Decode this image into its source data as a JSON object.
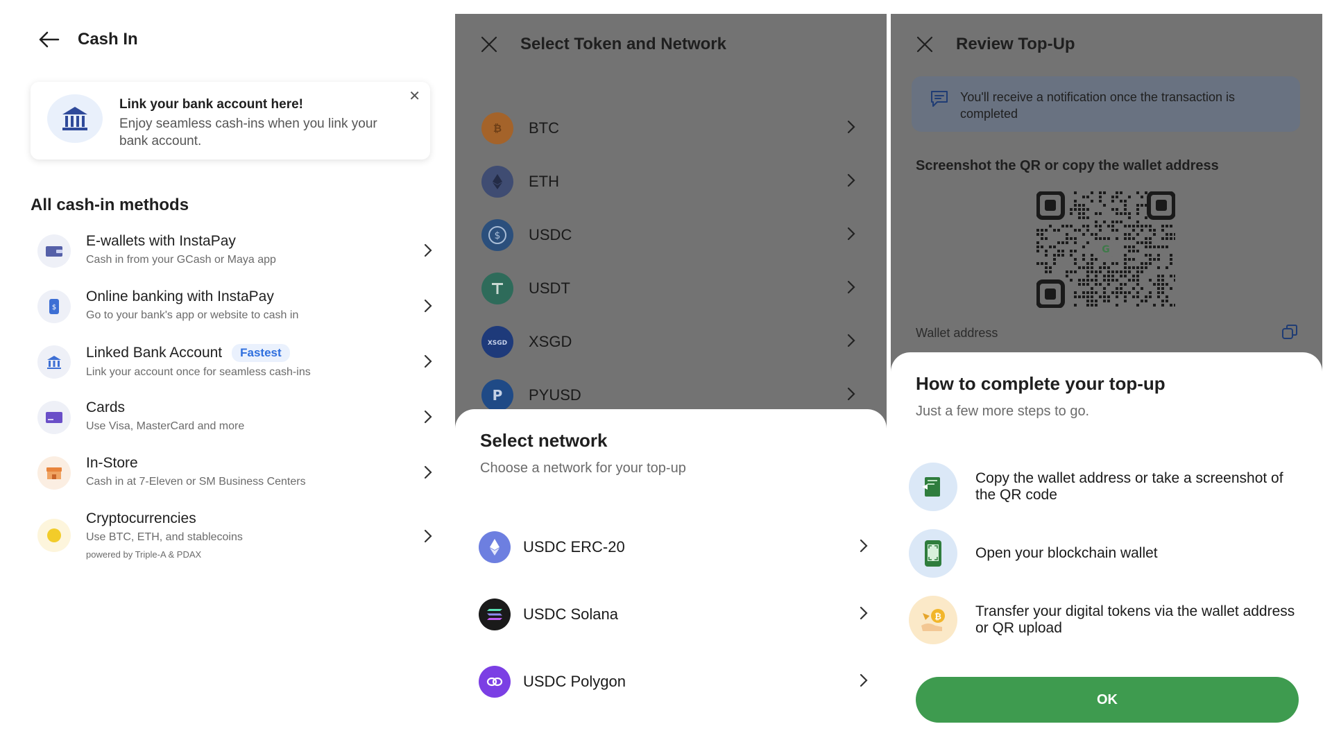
{
  "cash_in": {
    "title": "Cash In",
    "link_card": {
      "title": "Link your bank account here!",
      "body": "Enjoy seamless cash-ins when you link your bank account."
    },
    "section_title": "All cash-in methods",
    "methods": [
      {
        "title": "E-wallets with InstaPay",
        "subtitle": "Cash in from your GCash or Maya app",
        "icon": "wallet-icon"
      },
      {
        "title": "Online banking with InstaPay",
        "subtitle": "Go to your bank's app or website to cash in",
        "icon": "phone-icon"
      },
      {
        "title": "Linked Bank Account",
        "badge": "Fastest",
        "subtitle": "Link your account once for seamless cash-ins",
        "icon": "bank-icon"
      },
      {
        "title": "Cards",
        "subtitle": "Use Visa, MasterCard and more",
        "icon": "card-icon"
      },
      {
        "title": "In-Store",
        "subtitle": "Cash in at 7-Eleven or SM Business Centers",
        "icon": "store-icon"
      },
      {
        "title": "Cryptocurrencies",
        "subtitle": "Use BTC, ETH, and stablecoins",
        "note": "powered by Triple-A & PDAX",
        "icon": "coin-icon"
      }
    ]
  },
  "select_token": {
    "title": "Select Token and Network",
    "tokens": [
      {
        "label": "BTC",
        "color": "#a4632a"
      },
      {
        "label": "ETH",
        "color": "#3f4c72"
      },
      {
        "label": "USDC",
        "color": "#2b4f7c"
      },
      {
        "label": "USDT",
        "color": "#2e6b5a"
      },
      {
        "label": "XSGD",
        "color": "#1e3a7a"
      },
      {
        "label": "PYUSD",
        "color": "#1f4a86"
      }
    ],
    "sheet": {
      "title": "Select network",
      "subtitle": "Choose a network for your top-up",
      "networks": [
        {
          "label": "USDC ERC-20",
          "color": "#6d7fe0"
        },
        {
          "label": "USDC Solana",
          "color": "#1a1a1a"
        },
        {
          "label": "USDC Polygon",
          "color": "#7b3fe4"
        }
      ]
    }
  },
  "review": {
    "title": "Review Top-Up",
    "notification": "You'll receive a notification once the transaction is completed",
    "qr_title": "Screenshot the QR or copy the wallet address",
    "qr_center": "G",
    "wallet_label": "Wallet address",
    "sheet": {
      "title": "How to complete your top-up",
      "subtitle": "Just a few more steps to go.",
      "steps": [
        {
          "text": "Copy the wallet address or take a screenshot of the QR code"
        },
        {
          "text": "Open your blockchain wallet"
        },
        {
          "text": "Transfer your digital tokens via the wallet address or QR upload"
        }
      ],
      "ok_label": "OK"
    }
  },
  "colors": {
    "accent_green": "#3e9b4f",
    "badge_blue": "#2f6fde",
    "overlay": "#737373"
  }
}
